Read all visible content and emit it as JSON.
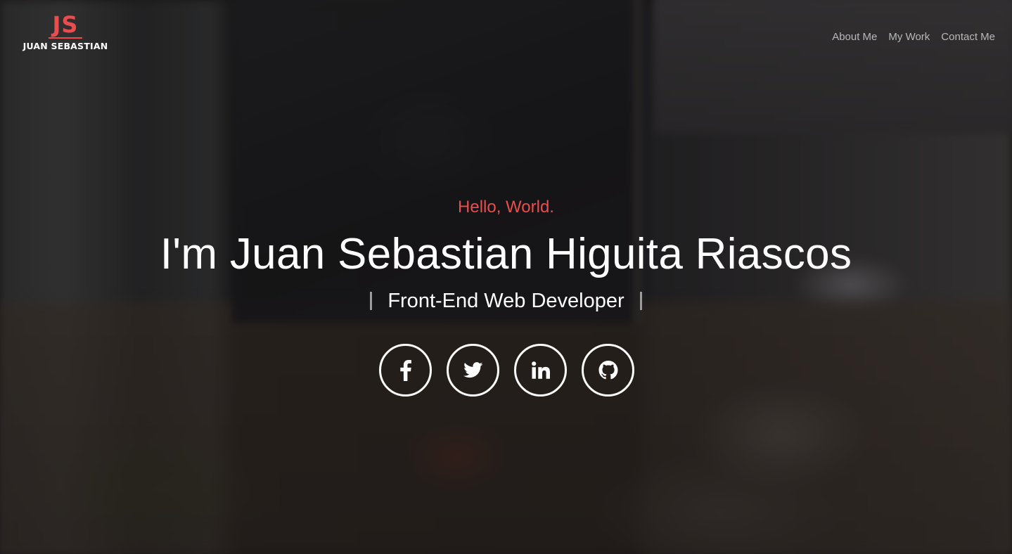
{
  "brand": {
    "mark": "JS",
    "name": "JUAN SEBASTIAN",
    "accent_color": "#e94d4d"
  },
  "nav": {
    "items": [
      {
        "label": "About Me"
      },
      {
        "label": "My Work"
      },
      {
        "label": "Contact Me"
      }
    ]
  },
  "hero": {
    "greeting": "Hello, World.",
    "name": "I'm Juan Sebastian Higuita Riascos",
    "role": "Front-End Web Developer"
  },
  "social": {
    "icons": [
      "facebook-icon",
      "twitter-icon",
      "linkedin-icon",
      "github-icon"
    ]
  }
}
